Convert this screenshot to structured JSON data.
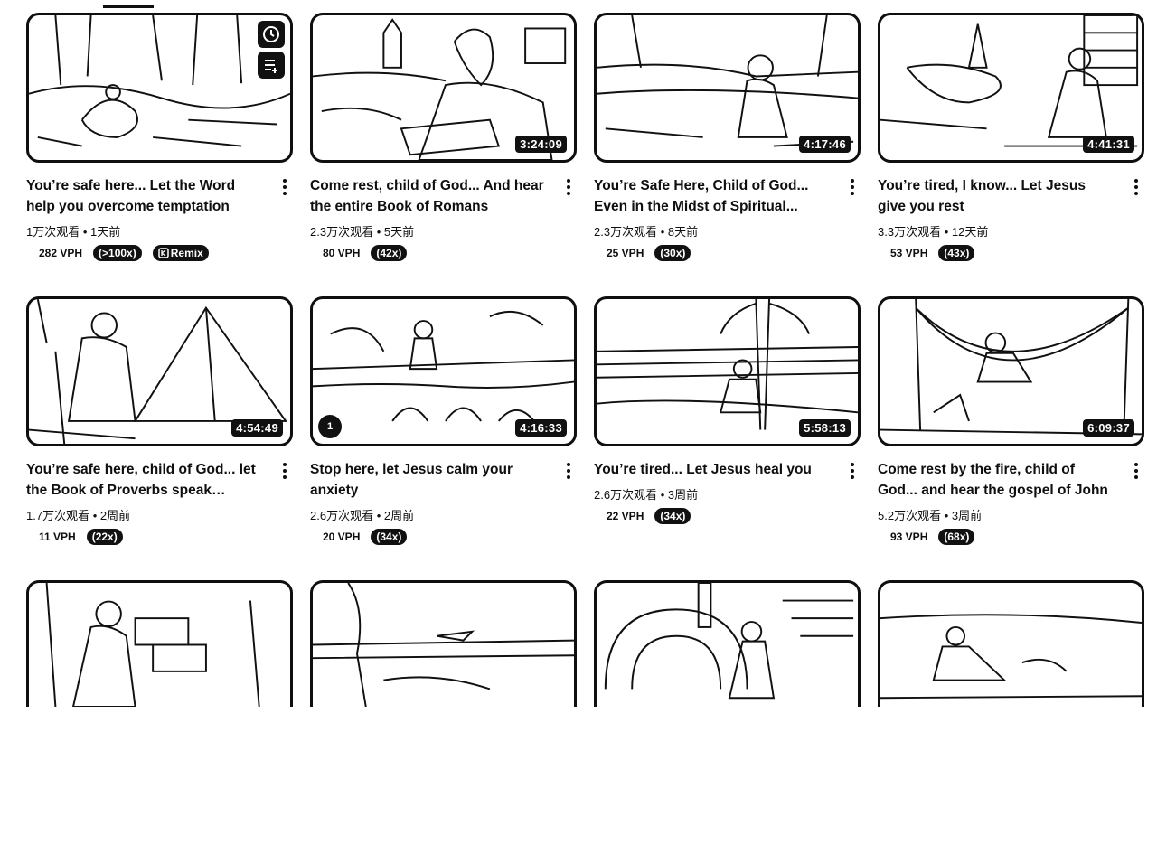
{
  "videos": [
    {
      "title": "You’re safe here... Let the Word help you overcome temptation",
      "duration": "",
      "views": "1万次观看",
      "age": "1天前",
      "vph": "282 VPH",
      "multiplier": "(>100x)",
      "remix_label": "Remix",
      "hover_icons": [
        "clock-icon",
        "queue-icon"
      ]
    },
    {
      "title": "Come rest, child of God... And hear the entire Book of Romans",
      "duration": "3:24:09",
      "views": "2.3万次观看",
      "age": "5天前",
      "vph": "80 VPH",
      "multiplier": "(42x)"
    },
    {
      "title": "You’re Safe Here, Child of God... Even in the Midst of Spiritual...",
      "duration": "4:17:46",
      "views": "2.3万次观看",
      "age": "8天前",
      "vph": "25 VPH",
      "multiplier": "(30x)"
    },
    {
      "title": "You’re tired, I know... Let Jesus give you rest",
      "duration": "4:41:31",
      "views": "3.3万次观看",
      "age": "12天前",
      "vph": "53 VPH",
      "multiplier": "(43x)"
    },
    {
      "title": "You’re safe here, child of God... let the Book of Proverbs speak wisdo...",
      "duration": "4:54:49",
      "views": "1.7万次观看",
      "age": "2周前",
      "vph": "11 VPH",
      "multiplier": "(22x)"
    },
    {
      "title": "Stop here, let Jesus calm your anxiety",
      "duration": "4:16:33",
      "views": "2.6万次观看",
      "age": "2周前",
      "vph": "20 VPH",
      "multiplier": "(34x)",
      "badge": "1"
    },
    {
      "title": "You’re tired... Let Jesus heal you",
      "duration": "5:58:13",
      "views": "2.6万次观看",
      "age": "3周前",
      "vph": "22 VPH",
      "multiplier": "(34x)"
    },
    {
      "title": "Come rest by the fire, child of God... and hear the gospel of John",
      "duration": "6:09:37",
      "views": "5.2万次观看",
      "age": "3周前",
      "vph": "93 VPH",
      "multiplier": "(68x)"
    },
    {
      "title": "",
      "duration": "",
      "views": "",
      "age": "",
      "vph": "",
      "multiplier": ""
    },
    {
      "title": "",
      "duration": "",
      "views": "",
      "age": "",
      "vph": "",
      "multiplier": ""
    },
    {
      "title": "",
      "duration": "",
      "views": "",
      "age": "",
      "vph": "",
      "multiplier": ""
    },
    {
      "title": "",
      "duration": "",
      "views": "",
      "age": "",
      "vph": "",
      "multiplier": ""
    }
  ],
  "separator": " • ",
  "colors": {
    "ink": "#0f0f0f",
    "badge_bg": "#111111",
    "badge_text": "#ffffff",
    "page_bg": "#ffffff"
  }
}
